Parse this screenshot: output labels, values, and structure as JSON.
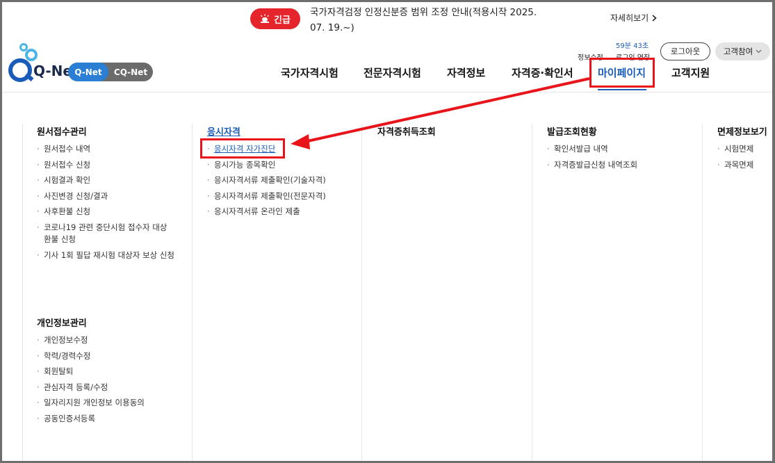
{
  "notice": {
    "badge": "긴급",
    "text": "국가자격검정 인정신분증 범위 조정 안내(적용시작 2025. 07. 19.~)",
    "detail": "자세히보기"
  },
  "logo": {
    "text": "Q-Net"
  },
  "site_switch": {
    "qnet": "Q-Net",
    "cqnet": "CQ-Net"
  },
  "utility": {
    "info_edit": "정보수정",
    "timer": "59분 43초",
    "extend": "로그인 연장",
    "logout": "로그아웃",
    "customer": "고객참여"
  },
  "nav": {
    "items": [
      {
        "label": "국가자격시험"
      },
      {
        "label": "전문자격시험"
      },
      {
        "label": "자격정보"
      },
      {
        "label": "자격증·확인서"
      },
      {
        "label": "마이페이지"
      },
      {
        "label": "고객지원"
      }
    ]
  },
  "menu": {
    "application": {
      "title": "원서접수관리",
      "items": [
        "원서접수 내역",
        "원서접수 신청",
        "시험결과 확인",
        "사진변경 신청/결과",
        "사후환불 신청",
        "코로나19 관련 중단시험 접수자 대상 환불 신청",
        "기사 1회 필답 재시험 대상자 보상 신청"
      ]
    },
    "personal": {
      "title": "개인정보관리",
      "items": [
        "개인정보수정",
        "학력/경력수정",
        "회원탈퇴",
        "관심자격 등록/수정",
        "일자리지원 개인정보 이용동의",
        "공동인증서등록"
      ]
    },
    "eligibility": {
      "title": "응시자격",
      "items": [
        "응시자격 자가진단",
        "응시가능 종목확인",
        "응시자격서류 제출확인(기술자격)",
        "응시자격서류 제출확인(전문자격)",
        "응시자격서류 온라인 제출"
      ]
    },
    "acquisition": {
      "title": "자격증취득조회"
    },
    "issuance": {
      "title": "발급조회현황",
      "items": [
        "확인서발급 내역",
        "자격증발급신청 내역조회"
      ]
    },
    "exemption": {
      "title": "면제정보보기",
      "items": [
        "시험면제",
        "과목면제"
      ]
    }
  }
}
